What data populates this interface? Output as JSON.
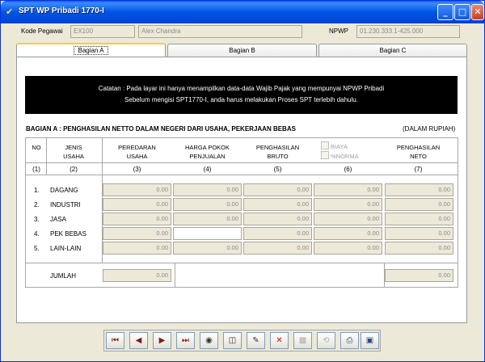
{
  "window": {
    "title": "SPT WP Pribadi 1770-I"
  },
  "header": {
    "kode_label": "Kode Pegawai",
    "kode_value": "EX100",
    "name_value": "Alex Chandra",
    "npwp_label": "NPWP",
    "npwp_value": "01.230.333.1-425.000"
  },
  "tabs": [
    "Bagian A",
    "Bagian B",
    "Bagian C"
  ],
  "note": {
    "line1": "Catatan : Pada layar ini hanya menampilkan data-data Wajib Pajak yang mempunyai NPWP Pribadi",
    "line2": "Sebelum mengisi SPT1770-I, anda harus melakukan Proses SPT terlebih dahulu."
  },
  "section": {
    "title": "BAGIAN A : PENGHASILAN NETTO DALAM NEGERI DARI USAHA, PEKERJAAN BEBAS",
    "unit": "(DALAM RUPIAH)"
  },
  "table": {
    "headers": {
      "no": "NO",
      "jenis1": "JENIS",
      "jenis2": "USAHA",
      "peredaran1": "PEREDARAN",
      "peredaran2": "USAHA",
      "hpp1": "HARGA POKOK",
      "hpp2": "PENJUALAN",
      "bruto1": "PENGHASILAN",
      "bruto2": "BRUTO",
      "biaya": "BIAYA",
      "norma": "%NORMA",
      "neto1": "PENGHASILAN",
      "neto2": "NETO"
    },
    "col_numbers": [
      "(1)",
      "(2)",
      "(3)",
      "(4)",
      "(5)",
      "(6)",
      "(7)"
    ],
    "rows": [
      {
        "no": "1.",
        "name": "DAGANG",
        "c3": "0.00",
        "c4": "0.00",
        "c5": "0.00",
        "c6": "0.00",
        "c7": "0.00"
      },
      {
        "no": "2.",
        "name": "INDUSTRI",
        "c3": "0.00",
        "c4": "0.00",
        "c5": "0.00",
        "c6": "0.00",
        "c7": "0.00"
      },
      {
        "no": "3.",
        "name": "JASA",
        "c3": "0.00",
        "c4": "0.00",
        "c5": "0.00",
        "c6": "0.00",
        "c7": "0.00"
      },
      {
        "no": "4.",
        "name": "PEK BEBAS",
        "c3": "0.00",
        "c4": "",
        "c5": "0.00",
        "c6": "0.00",
        "c7": "0.00"
      },
      {
        "no": "5.",
        "name": "LAIN-LAIN",
        "c3": "0.00",
        "c4": "0.00",
        "c5": "0.00",
        "c6": "0.00",
        "c7": "0.00"
      }
    ],
    "total_label": "JUMLAH",
    "total_c3": "0.00",
    "total_c7": "0.00"
  },
  "toolbar": {
    "buttons": [
      "first-record",
      "previous-record",
      "next-record",
      "last-record",
      "find",
      "new",
      "edit",
      "delete",
      "save",
      "undo",
      "print",
      "exit"
    ]
  }
}
